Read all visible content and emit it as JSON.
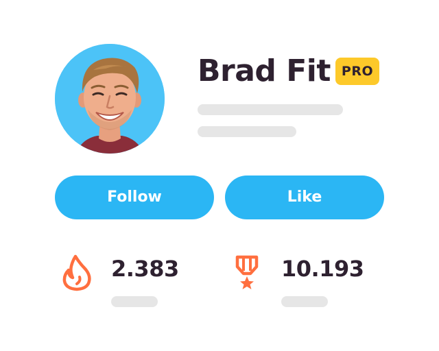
{
  "profile": {
    "name": "Brad Fit",
    "badge": "PRO"
  },
  "actions": {
    "follow_label": "Follow",
    "like_label": "Like"
  },
  "stats": {
    "streak_value": "2.383",
    "rank_value": "10.193",
    "streak_icon": "flame-icon",
    "rank_icon": "medal-icon"
  },
  "colors": {
    "accent": "#2bb6f4",
    "avatar_bg": "#4cc3f7",
    "badge": "#fdc92a",
    "icon": "#ff6f3f",
    "text": "#2e2130",
    "placeholder": "#e6e6e6"
  }
}
